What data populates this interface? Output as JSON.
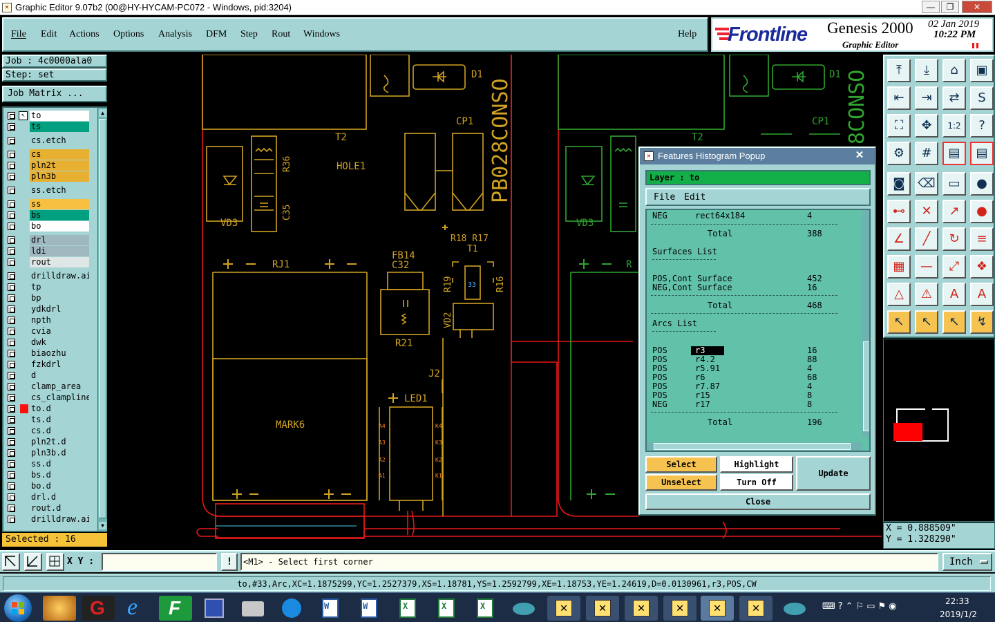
{
  "window": {
    "title": "Graphic Editor 9.07b2 (00@HY-HYCAM-PC072 - Windows, pid:3204)",
    "minimize": "—",
    "maximize": "❐",
    "close": "✕"
  },
  "menubar": {
    "items": [
      "File",
      "Edit",
      "Actions",
      "Options",
      "Analysis",
      "DFM",
      "Step",
      "Rout",
      "Windows"
    ],
    "help": "Help"
  },
  "brand": {
    "logo": "Frontline",
    "product": "Genesis 2000",
    "subtitle": "Graphic Editor",
    "date": "02 Jan 2019",
    "time": "10:22 PM"
  },
  "job": {
    "job_label": "Job : 4c0000ala0",
    "step_label": "Step: set",
    "matrix_button": "Job Matrix ..."
  },
  "layers": [
    {
      "name": "to",
      "color": "#ffffff",
      "active": true
    },
    {
      "name": "ts",
      "color": "#00a080"
    },
    {
      "name": "cs.etch",
      "color": "#a5d4d4"
    },
    {
      "name": "cs",
      "color": "#e8b030"
    },
    {
      "name": "pln2t",
      "color": "#e8b030"
    },
    {
      "name": "pln3b",
      "color": "#e8b030"
    },
    {
      "name": "ss.etch",
      "color": "#a5d4d4"
    },
    {
      "name": "ss",
      "color": "#f7c040"
    },
    {
      "name": "bs",
      "color": "#00a080"
    },
    {
      "name": "bo",
      "color": "#ffffff"
    },
    {
      "name": "drl",
      "color": "#9fb8bf"
    },
    {
      "name": "ldi",
      "color": "#9fb8bf"
    },
    {
      "name": "rout",
      "color": "#dfe6e6"
    },
    {
      "name": "drilldraw.ai",
      "color": "#a5d4d4"
    },
    {
      "name": "tp",
      "color": "#a5d4d4"
    },
    {
      "name": "bp",
      "color": "#a5d4d4"
    },
    {
      "name": "ydkdrl",
      "color": "#a5d4d4"
    },
    {
      "name": "npth",
      "color": "#a5d4d4"
    },
    {
      "name": "cvia",
      "color": "#a5d4d4"
    },
    {
      "name": "dwk",
      "color": "#a5d4d4"
    },
    {
      "name": "biaozhu",
      "color": "#a5d4d4"
    },
    {
      "name": "fzkdrl",
      "color": "#a5d4d4"
    },
    {
      "name": "d",
      "color": "#a5d4d4"
    },
    {
      "name": "clamp_area",
      "color": "#a5d4d4"
    },
    {
      "name": "cs_clampline",
      "color": "#a5d4d4"
    },
    {
      "name": "to.d",
      "color": "#a5d4d4",
      "marked": true
    },
    {
      "name": "ts.d",
      "color": "#a5d4d4"
    },
    {
      "name": "cs.d",
      "color": "#a5d4d4"
    },
    {
      "name": "pln2t.d",
      "color": "#a5d4d4"
    },
    {
      "name": "pln3b.d",
      "color": "#a5d4d4"
    },
    {
      "name": "ss.d",
      "color": "#a5d4d4"
    },
    {
      "name": "bs.d",
      "color": "#a5d4d4"
    },
    {
      "name": "bo.d",
      "color": "#a5d4d4"
    },
    {
      "name": "drl.d",
      "color": "#a5d4d4"
    },
    {
      "name": "rout.d",
      "color": "#a5d4d4"
    },
    {
      "name": "drilldraw.ai",
      "color": "#a5d4d4"
    }
  ],
  "selected": "Selected : 16",
  "canvas": {
    "labels": [
      "D1",
      "CP1",
      "T2",
      "HOLE1",
      "R36",
      "C35",
      "VD3",
      "PB028CONSO",
      "RJ1",
      "FB14",
      "C32",
      "R18 R17",
      "T1",
      "R19",
      "R16",
      "VD2",
      "R21",
      "J2",
      "LED1",
      "MARK6",
      "A4",
      "A3",
      "A2",
      "A1",
      "K4",
      "K3",
      "K2",
      "K1",
      "33",
      "8CONSO",
      "R"
    ]
  },
  "popup": {
    "title": "Features Histogram Popup",
    "close_x": "✕",
    "layer_label": "Layer :  to",
    "menu": [
      "File",
      "Edit"
    ],
    "rows": [
      {
        "a": "NEG",
        "b": "rect64x184",
        "c": "4"
      },
      {
        "a": "",
        "b": "Total",
        "c": "388"
      },
      {
        "a": "Surfaces List",
        "b": "",
        "c": ""
      },
      {
        "a": "POS,Cont Surface",
        "b": "",
        "c": "452"
      },
      {
        "a": "NEG,Cont Surface",
        "b": "",
        "c": "16"
      },
      {
        "a": "",
        "b": "Total",
        "c": "468"
      },
      {
        "a": "Arcs List",
        "b": "",
        "c": ""
      },
      {
        "a": "POS",
        "b": "r3",
        "c": "16"
      },
      {
        "a": "POS",
        "b": "r4.2",
        "c": "88"
      },
      {
        "a": "POS",
        "b": "r5.91",
        "c": "4"
      },
      {
        "a": "POS",
        "b": "r6",
        "c": "68"
      },
      {
        "a": "POS",
        "b": "r7.87",
        "c": "4"
      },
      {
        "a": "POS",
        "b": "r15",
        "c": "8"
      },
      {
        "a": "NEG",
        "b": "r17",
        "c": "8"
      },
      {
        "a": "",
        "b": "Total",
        "c": "196"
      }
    ],
    "buttons": {
      "select": "Select",
      "highlight": "Highlight",
      "update": "Update",
      "unselect": "Unselect",
      "turn_off": "Turn Off",
      "close": "Close"
    }
  },
  "coords": {
    "x": "X = 0.888509\"",
    "y": "Y = 1.328290\""
  },
  "bottom": {
    "xy_label": "X Y :",
    "xy_value": "",
    "prompt": "<M1> - Select first corner",
    "units": "Inch",
    "status": "to,#33,Arc,XC=1.1875299,YC=1.2527379,XS=1.18781,YS=1.2592799,XE=1.18753,YE=1.24619,D=0.0130961,r3,POS,CW"
  },
  "taskbar": {
    "time": "22:33",
    "date": "2019/1/2"
  }
}
